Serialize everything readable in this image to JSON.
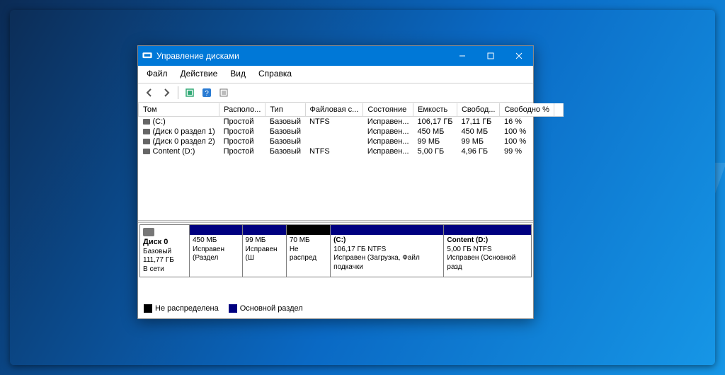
{
  "title": "Управление дисками",
  "menu": {
    "file": "Файл",
    "action": "Действие",
    "view": "Вид",
    "help": "Справка"
  },
  "cols": {
    "volume": "Том",
    "layout": "Располо...",
    "type": "Тип",
    "fs": "Файловая с...",
    "status": "Состояние",
    "capacity": "Емкость",
    "free": "Свобод...",
    "freepct": "Свободно %"
  },
  "volumes": [
    {
      "name": "(C:)",
      "layout": "Простой",
      "type": "Базовый",
      "fs": "NTFS",
      "status": "Исправен...",
      "capacity": "106,17 ГБ",
      "free": "17,11 ГБ",
      "freepct": "16 %"
    },
    {
      "name": "(Диск 0 раздел 1)",
      "layout": "Простой",
      "type": "Базовый",
      "fs": "",
      "status": "Исправен...",
      "capacity": "450 МБ",
      "free": "450 МБ",
      "freepct": "100 %"
    },
    {
      "name": "(Диск 0 раздел 2)",
      "layout": "Простой",
      "type": "Базовый",
      "fs": "",
      "status": "Исправен...",
      "capacity": "99 МБ",
      "free": "99 МБ",
      "freepct": "100 %"
    },
    {
      "name": "Content (D:)",
      "layout": "Простой",
      "type": "Базовый",
      "fs": "NTFS",
      "status": "Исправен...",
      "capacity": "5,00 ГБ",
      "free": "4,96 ГБ",
      "freepct": "99 %"
    }
  ],
  "disk": {
    "name": "Диск 0",
    "type": "Базовый",
    "size": "111,77 ГБ",
    "status": "В сети"
  },
  "partitions": [
    {
      "kind": "primary",
      "flex": 12,
      "title": "",
      "size": "450 МБ",
      "status": "Исправен (Раздел"
    },
    {
      "kind": "primary",
      "flex": 10,
      "title": "",
      "size": "99 МБ",
      "status": "Исправен (Ш"
    },
    {
      "kind": "unalloc",
      "flex": 10,
      "title": "",
      "size": "70 МБ",
      "status": "Не распред"
    },
    {
      "kind": "primary",
      "flex": 26,
      "title": "(C:)",
      "size": "106,17 ГБ NTFS",
      "status": "Исправен (Загрузка, Файл подкачки"
    },
    {
      "kind": "primary",
      "flex": 20,
      "title": "Content  (D:)",
      "size": "5,00 ГБ NTFS",
      "status": "Исправен (Основной разд"
    }
  ],
  "legend": {
    "unalloc": "Не распределена",
    "primary": "Основной раздел"
  }
}
